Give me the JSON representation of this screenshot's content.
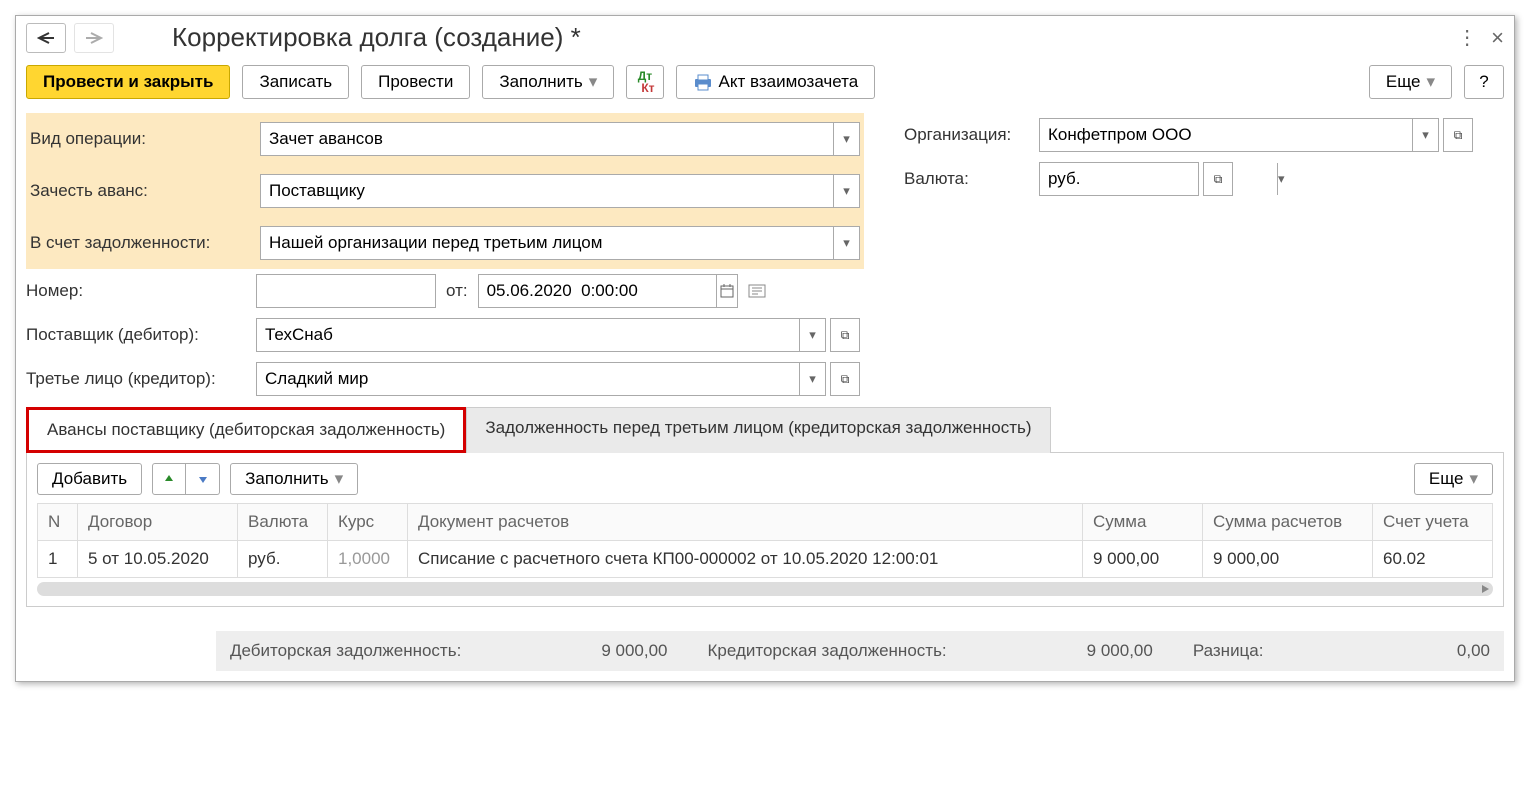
{
  "title": "Корректировка долга (создание) *",
  "toolbar": {
    "post_and_close": "Провести и закрыть",
    "save": "Записать",
    "post": "Провести",
    "fill": "Заполнить",
    "offset_act": "Акт взаимозачета",
    "more": "Еще",
    "help": "?"
  },
  "form": {
    "op_type_label": "Вид операции:",
    "op_type_value": "Зачет авансов",
    "advance_label": "Зачесть аванс:",
    "advance_value": "Поставщику",
    "debt_label": "В счет задолженности:",
    "debt_value": "Нашей организации перед третьим лицом",
    "number_label": "Номер:",
    "number_value": "",
    "from_label": "от:",
    "date_value": "05.06.2020  0:00:00",
    "supplier_label": "Поставщик (дебитор):",
    "supplier_value": "ТехСнаб",
    "third_label": "Третье лицо (кредитор):",
    "third_value": "Сладкий мир",
    "org_label": "Организация:",
    "org_value": "Конфетпром ООО",
    "currency_label": "Валюта:",
    "currency_value": "руб."
  },
  "tabs": {
    "t1": "Авансы поставщику (дебиторская задолженность)",
    "t2": "Задолженность перед третьим лицом (кредиторская задолженность)"
  },
  "tab_toolbar": {
    "add": "Добавить",
    "fill": "Заполнить",
    "more": "Еще"
  },
  "grid": {
    "headers": {
      "n": "N",
      "contract": "Договор",
      "currency": "Валюта",
      "rate": "Курс",
      "doc": "Документ расчетов",
      "sum": "Сумма",
      "sum_calc": "Сумма расчетов",
      "account": "Счет учета"
    },
    "rows": [
      {
        "n": "1",
        "contract": "5 от 10.05.2020",
        "currency": "руб.",
        "rate": "1,0000",
        "doc": "Списание с расчетного счета КП00-000002 от 10.05.2020 12:00:01",
        "sum": "9 000,00",
        "sum_calc": "9 000,00",
        "account": "60.02"
      }
    ]
  },
  "footer": {
    "debit_label": "Дебиторская задолженность:",
    "debit_value": "9 000,00",
    "credit_label": "Кредиторская задолженность:",
    "credit_value": "9 000,00",
    "diff_label": "Разница:",
    "diff_value": "0,00"
  }
}
